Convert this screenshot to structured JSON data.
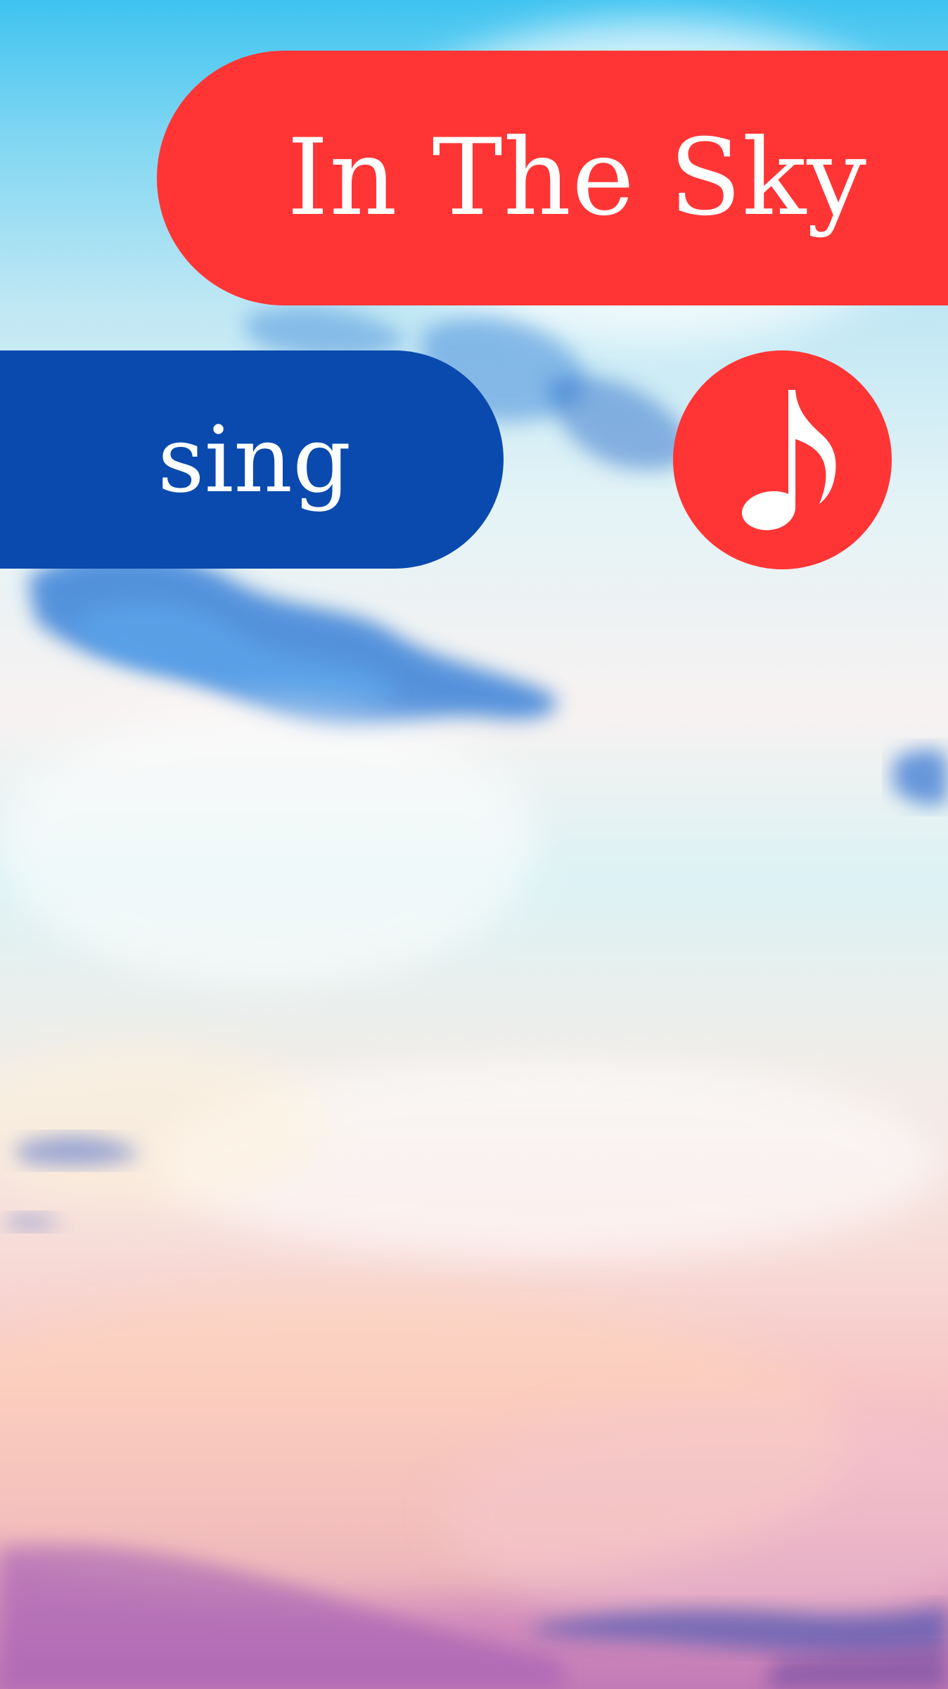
{
  "app": {
    "title": "In The Sky",
    "sing_label": "sing",
    "music_icon": "music-note-icon"
  },
  "colors": {
    "title_pill": "#ff3535",
    "sing_pill": "#0a4aae",
    "music_button": "#ff3535",
    "text": "#ffffff"
  }
}
